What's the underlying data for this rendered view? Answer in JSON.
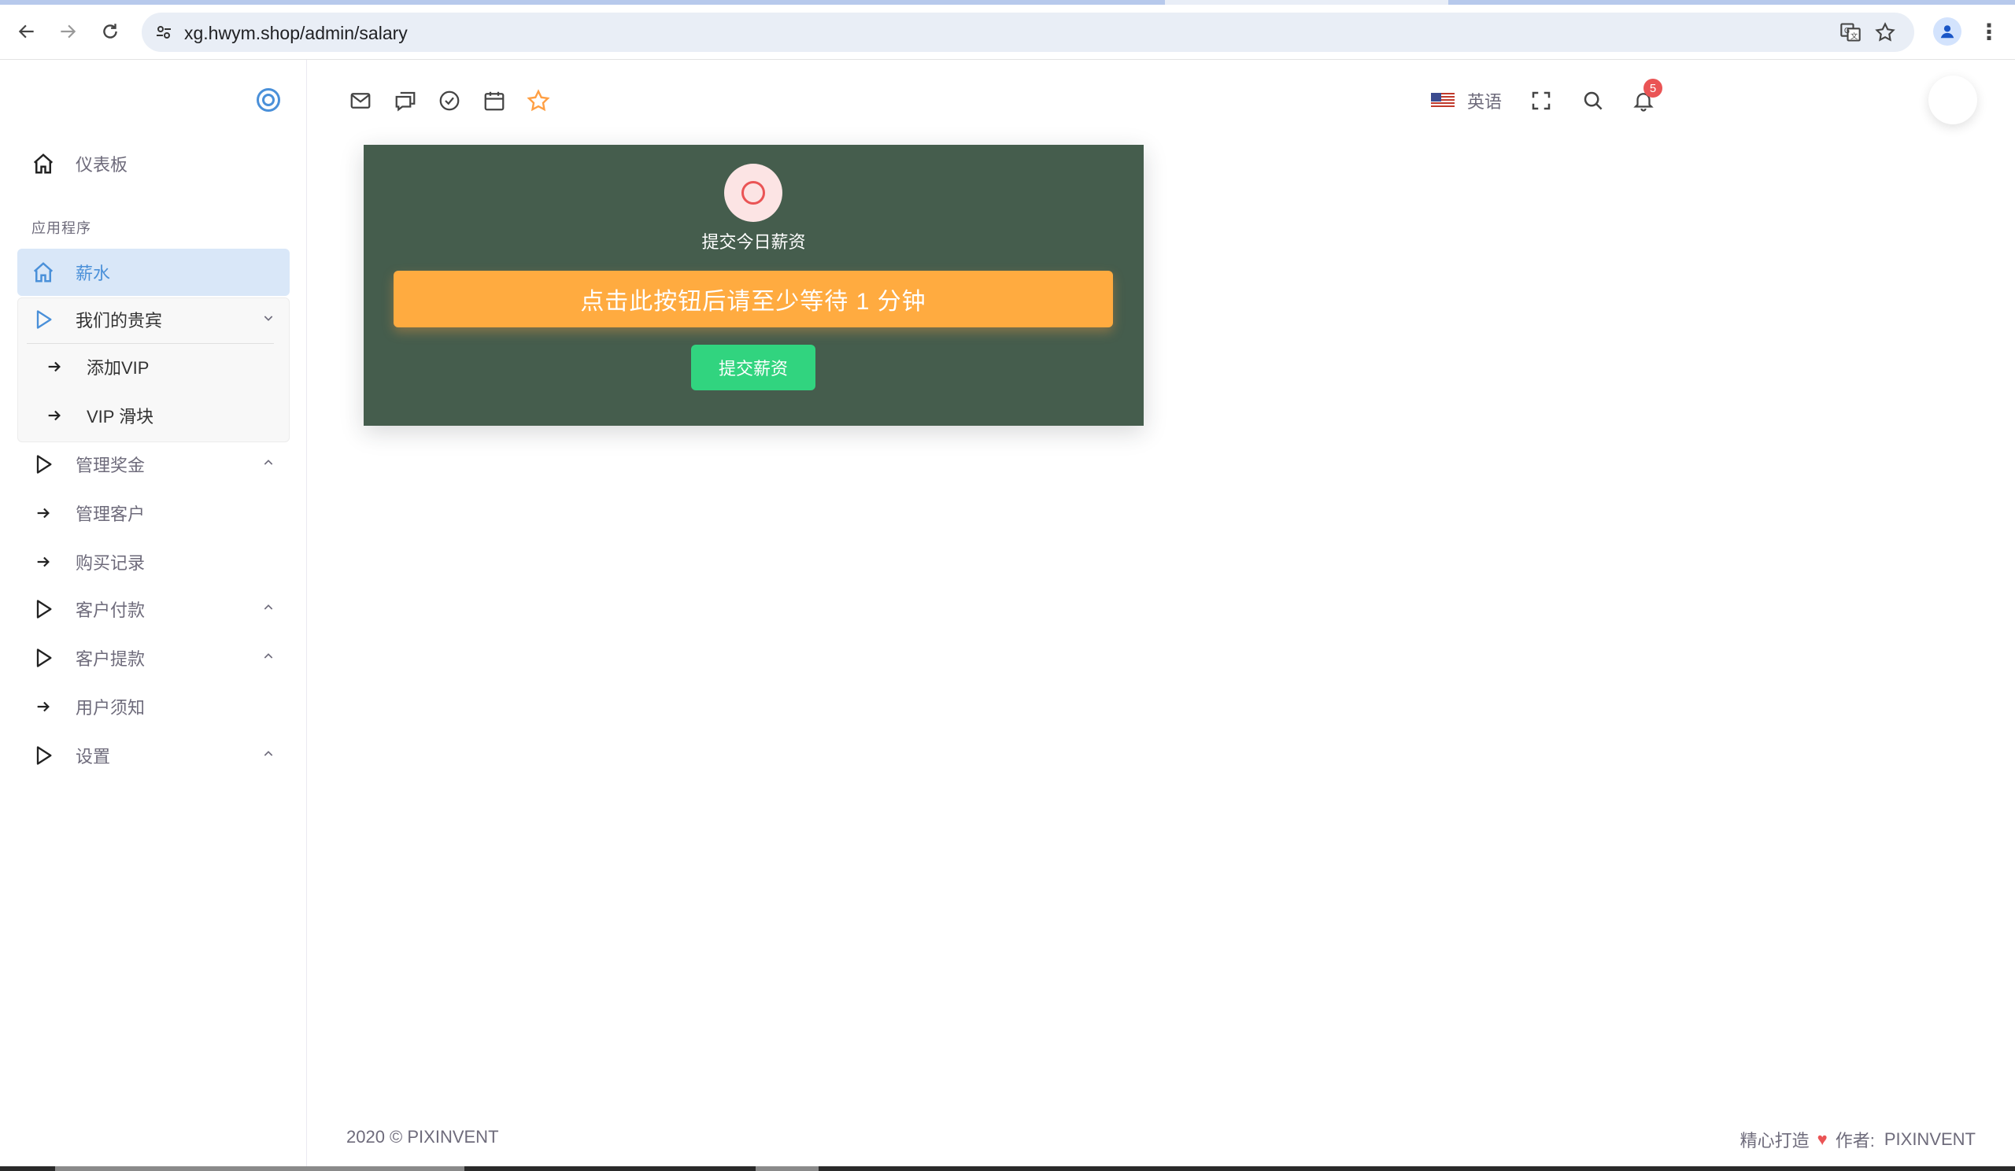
{
  "browser": {
    "url": "xg.hwym.shop/admin/salary"
  },
  "sidebar": {
    "section_title": "应用程序",
    "items": [
      {
        "label": "仪表板"
      },
      {
        "label": "薪水"
      },
      {
        "label": "我们的贵宾"
      },
      {
        "label": "添加VIP"
      },
      {
        "label": "VIP 滑块"
      },
      {
        "label": "管理奖金"
      },
      {
        "label": "管理客户"
      },
      {
        "label": "购买记录"
      },
      {
        "label": "客户付款"
      },
      {
        "label": "客户提款"
      },
      {
        "label": "用户须知"
      },
      {
        "label": "设置"
      }
    ]
  },
  "topnav": {
    "language": "英语",
    "notification_count": "5"
  },
  "card": {
    "title": "提交今日薪资",
    "warning": "点击此按钮后请至少等待 1 分钟",
    "submit_label": "提交薪资"
  },
  "footer": {
    "copyright": "2020 © PIXINVENT",
    "made_with": "精心打造",
    "author_prefix": "作者:",
    "author": "PIXINVENT"
  },
  "colors": {
    "card_bg": "#455d4d",
    "warning": "#ffab40",
    "submit": "#31d47f",
    "active": "#4a90d9",
    "badge": "#ea5455"
  }
}
